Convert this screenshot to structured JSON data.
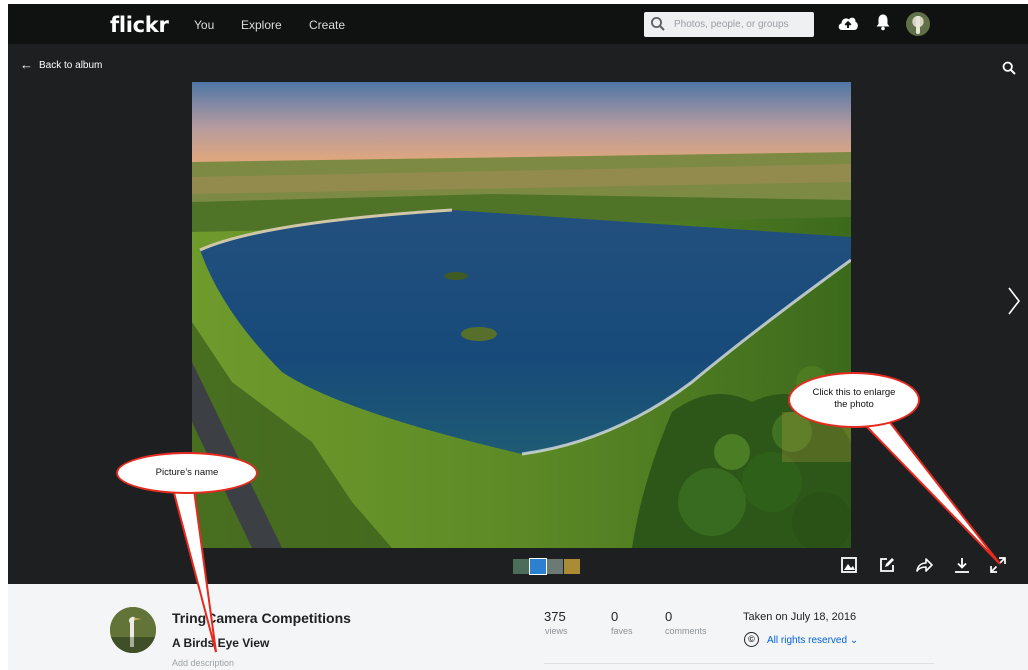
{
  "nav": {
    "logo": "flickr",
    "links": [
      "You",
      "Explore",
      "Create"
    ],
    "search_placeholder": "Photos, people, or groups",
    "icons": [
      "upload-cloud-icon",
      "notifications-bell-icon",
      "user-avatar"
    ]
  },
  "viewer": {
    "back_label": "Back to album",
    "icons": [
      "search-icon",
      "next-arrow-icon"
    ],
    "tools": [
      "view-image-icon",
      "edit-icon",
      "share-icon",
      "download-icon",
      "enlarge-icon"
    ]
  },
  "photo_info": {
    "owner": "TringCamera Competitions",
    "title": "A Birds Eye View",
    "description_placeholder": "Add description",
    "stats": [
      {
        "value": "375",
        "label": "views"
      },
      {
        "value": "0",
        "label": "faves"
      },
      {
        "value": "0",
        "label": "comments"
      }
    ],
    "taken": "Taken on July 18, 2016",
    "license": "All rights reserved",
    "license_icon": "©"
  },
  "annotations": {
    "name_callout": "Picture’s name",
    "enlarge_callout_line1": "Click this to enlarge",
    "enlarge_callout_line2": "the photo"
  },
  "colors": {
    "topbar": "#101111",
    "viewer_bg": "#1e1f21",
    "link_blue": "#0063dc",
    "callout_red": "#e52a1f"
  }
}
